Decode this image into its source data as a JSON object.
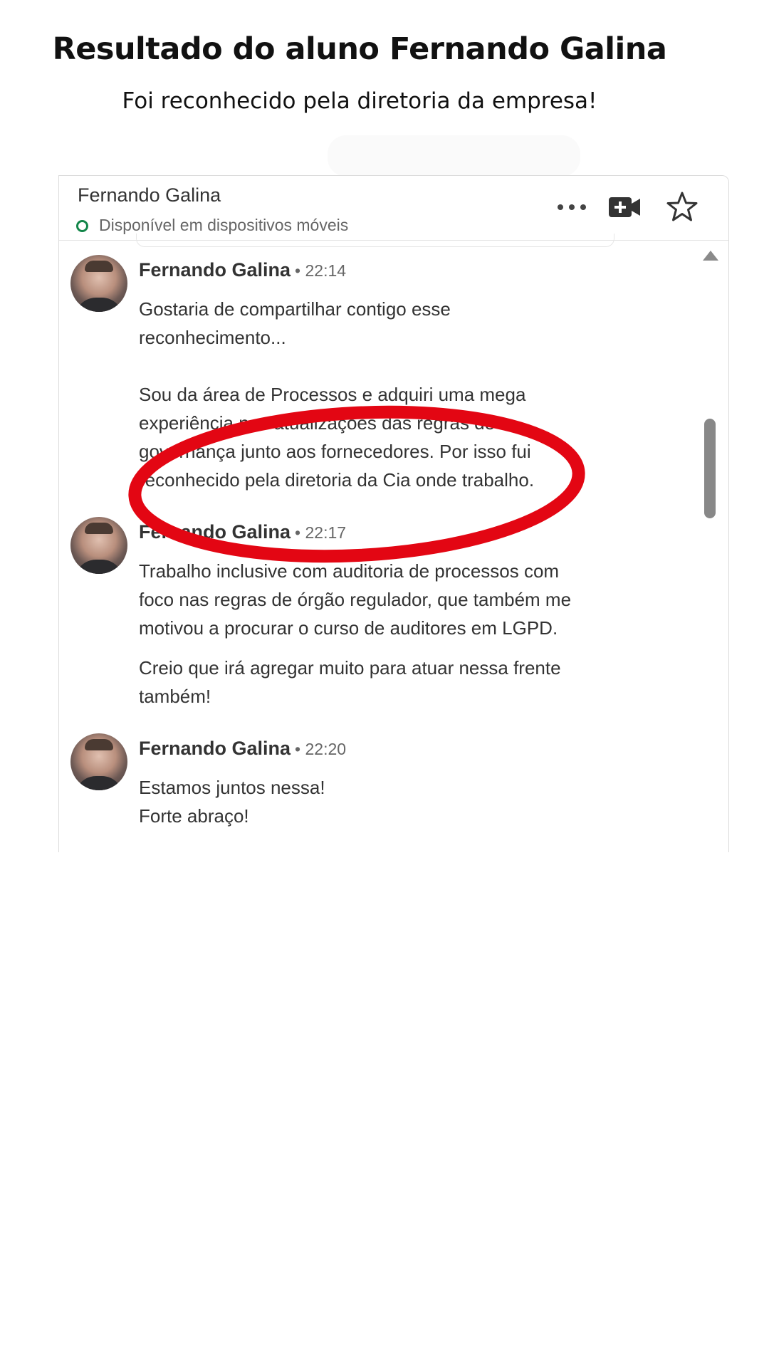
{
  "headline": "Resultado do aluno Fernando Galina",
  "subheadline": "Foi reconhecido pela diretoria da empresa!",
  "chat": {
    "contact_name": "Fernando Galina",
    "status": "Disponível em dispositivos móveis",
    "header_icons": [
      "more-icon",
      "video-call-icon",
      "star-icon"
    ],
    "status_color": "#13864a",
    "messages": [
      {
        "sender": "Fernando Galina",
        "time": "• 22:14",
        "text": "Gostaria de compartilhar contigo esse\nreconhecimento...\n\nSou da área de Processos e adquiri uma mega\nexperiência nas atualizações das regras de\ngovernança junto aos fornecedores. Por isso fui\nreconhecido pela diretoria da Cia onde trabalho."
      },
      {
        "sender": "Fernando Galina",
        "time": "• 22:17",
        "text": "Trabalho inclusive com auditoria de processos com\nfoco nas regras de órgão regulador, que também me\nmotivou a procurar o curso de auditores em LGPD.",
        "text2": "Creio que irá agregar muito para atuar nessa frente\ntambém!"
      },
      {
        "sender": "Fernando Galina",
        "time": "• 22:20",
        "text": "Estamos juntos nessa!\nForte abraço!"
      }
    ]
  },
  "annotation_color": "#e30613"
}
